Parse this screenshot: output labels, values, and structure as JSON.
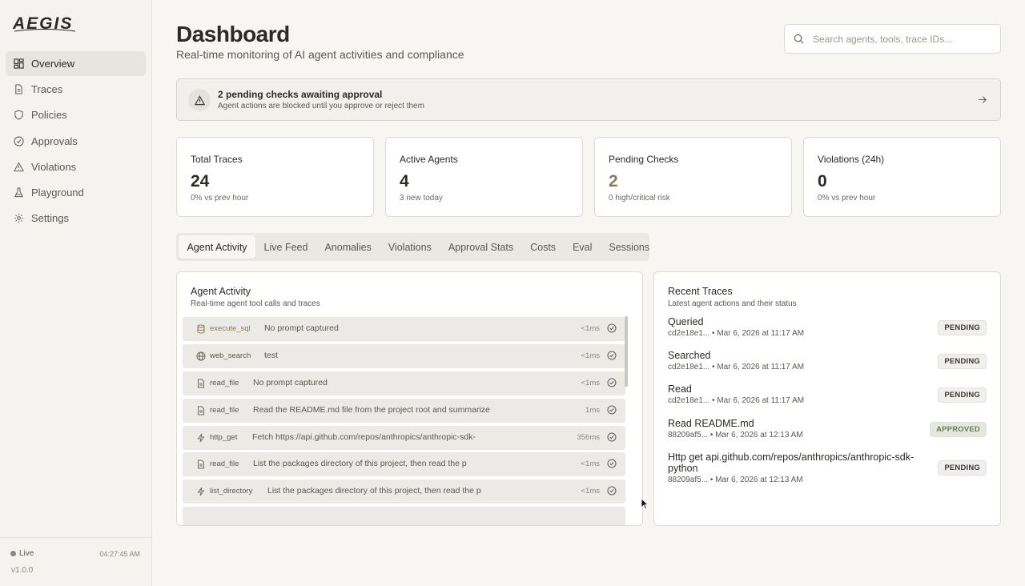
{
  "app": {
    "logo_text": "AEGIS"
  },
  "sidebar": {
    "items": [
      {
        "label": "Overview",
        "icon": "grid-icon"
      },
      {
        "label": "Traces",
        "icon": "file-icon"
      },
      {
        "label": "Policies",
        "icon": "shield-icon"
      },
      {
        "label": "Approvals",
        "icon": "check-circle-icon"
      },
      {
        "label": "Violations",
        "icon": "warning-icon"
      },
      {
        "label": "Playground",
        "icon": "flask-icon"
      },
      {
        "label": "Settings",
        "icon": "gear-icon"
      }
    ],
    "active": "Overview",
    "status": "Live",
    "clock": "04:27:45 AM",
    "version": "v1.0.0"
  },
  "header": {
    "title": "Dashboard",
    "subtitle": "Real-time monitoring of AI agent activities and compliance",
    "search_placeholder": "Search agents, tools, trace IDs..."
  },
  "banner": {
    "title": "2 pending checks awaiting approval",
    "subtitle": "Agent actions are blocked until you approve or reject them"
  },
  "stats": [
    {
      "label": "Total Traces",
      "value": "24",
      "sub": "0% vs prev hour"
    },
    {
      "label": "Active Agents",
      "value": "4",
      "sub": "3 new today"
    },
    {
      "label": "Pending Checks",
      "value": "2",
      "sub": "0 high/critical risk"
    },
    {
      "label": "Violations (24h)",
      "value": "0",
      "sub": "0% vs prev hour"
    }
  ],
  "tabs": [
    "Agent Activity",
    "Live Feed",
    "Anomalies",
    "Violations",
    "Approval Stats",
    "Costs",
    "Eval",
    "Sessions"
  ],
  "activity": {
    "title": "Agent Activity",
    "subtitle": "Real-time agent tool calls and traces",
    "rows": [
      {
        "tool": "execute_sql",
        "desc": "No prompt captured",
        "duration": "<1ms",
        "icon": "database-icon"
      },
      {
        "tool": "web_search",
        "desc": "test",
        "duration": "<1ms",
        "icon": "globe-icon"
      },
      {
        "tool": "read_file",
        "desc": "No prompt captured",
        "duration": "<1ms",
        "icon": "file-icon"
      },
      {
        "tool": "read_file",
        "desc": "Read the README.md file from the project root and summarize",
        "duration": "1ms",
        "icon": "file-icon"
      },
      {
        "tool": "http_get",
        "desc": "Fetch https://api.github.com/repos/anthropics/anthropic-sdk-",
        "duration": "356ms",
        "icon": "bolt-icon"
      },
      {
        "tool": "read_file",
        "desc": "List the packages directory of this project, then read the p",
        "duration": "<1ms",
        "icon": "file-icon"
      },
      {
        "tool": "list_directory",
        "desc": "List the packages directory of this project, then read the p",
        "duration": "<1ms",
        "icon": "bolt-icon"
      }
    ]
  },
  "recent_traces": {
    "title": "Recent Traces",
    "subtitle": "Latest agent actions and their status",
    "items": [
      {
        "title": "Queried",
        "meta": "cd2e18e1... • Mar 6, 2026 at 11:17 AM",
        "status": "PENDING"
      },
      {
        "title": "Searched",
        "meta": "cd2e18e1... • Mar 6, 2026 at 11:17 AM",
        "status": "PENDING"
      },
      {
        "title": "Read",
        "meta": "cd2e18e1... • Mar 6, 2026 at 11:17 AM",
        "status": "PENDING"
      },
      {
        "title": "Read README.md",
        "meta": "88209af5... • Mar 6, 2026 at 12:13 AM",
        "status": "APPROVED"
      },
      {
        "title": "Http get api.github.com/repos/anthropics/anthropic-sdk-python",
        "meta": "88209af5... • Mar 6, 2026 at 12:13 AM",
        "status": "PENDING"
      }
    ]
  },
  "colors": {
    "accent": "#8a7a5c",
    "approved": "#6b7a60",
    "background": "#f7f6f3"
  }
}
